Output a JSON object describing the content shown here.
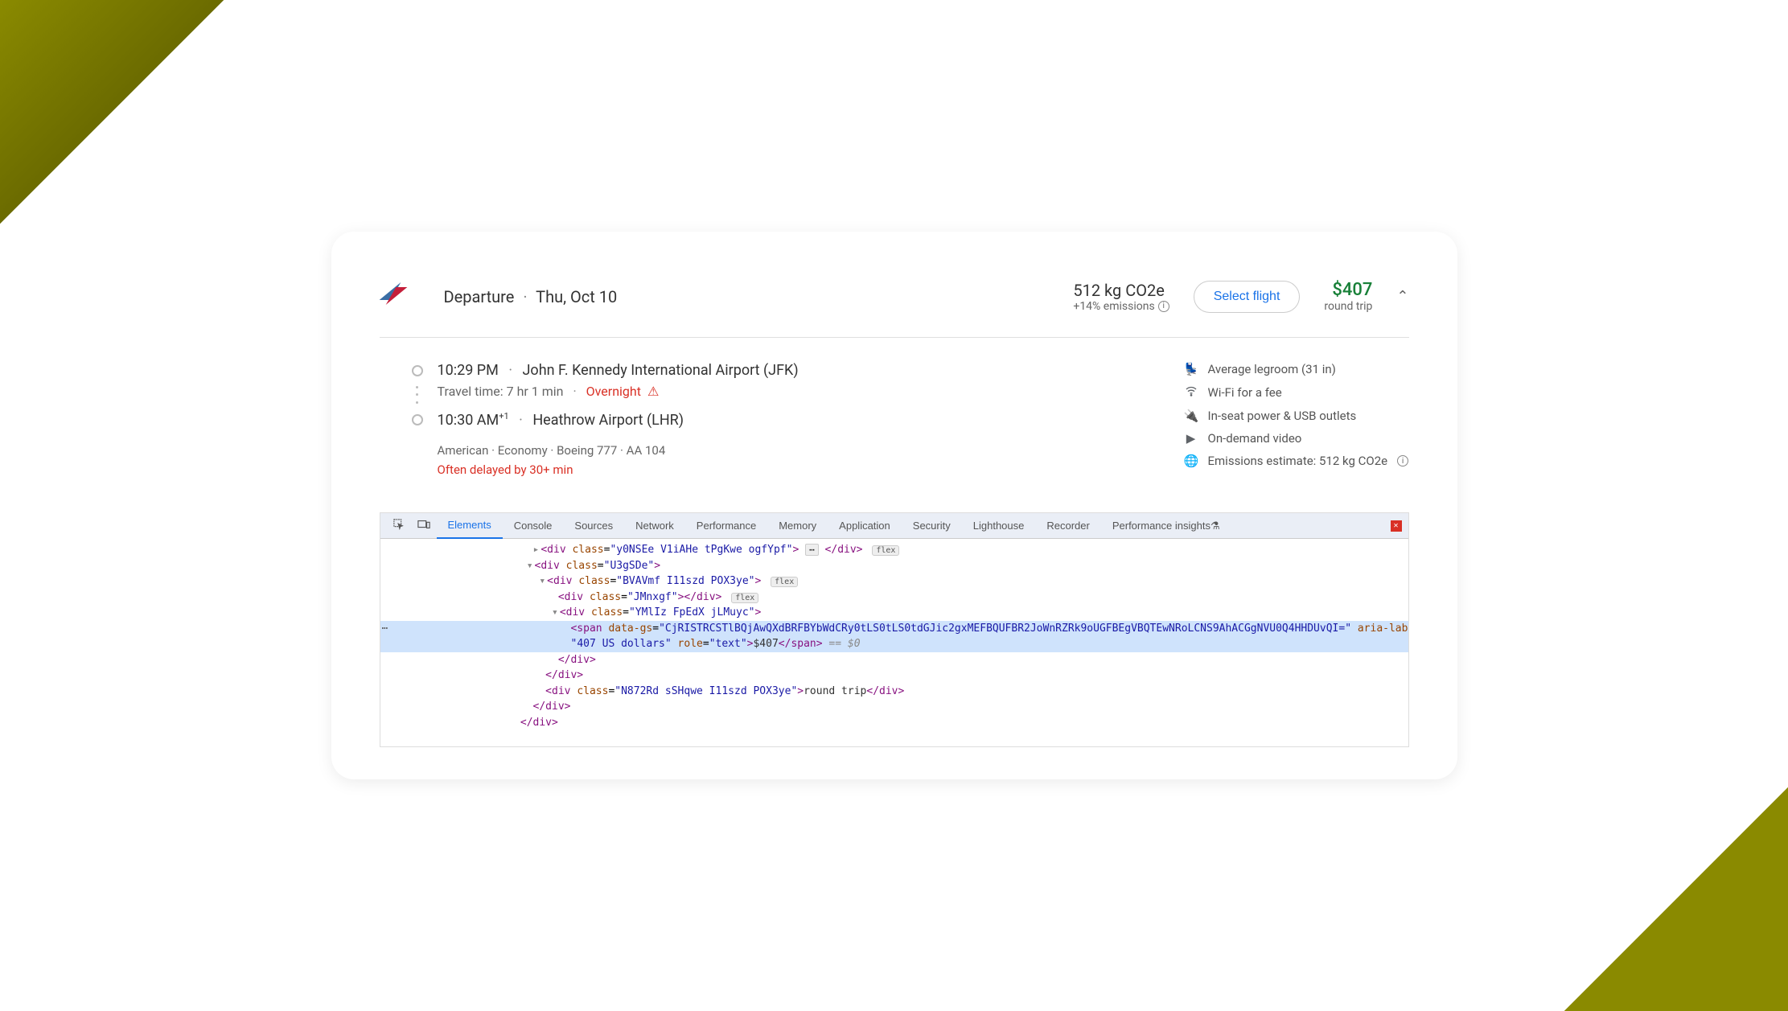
{
  "header": {
    "departure_label": "Departure",
    "date": "Thu, Oct 10"
  },
  "emissions": {
    "main": "512 kg CO2e",
    "delta": "+14% emissions"
  },
  "select_button": "Select flight",
  "price": "$407",
  "trip_type": "round trip",
  "itinerary": {
    "origin_time": "10:29 PM",
    "origin_airport": "John F. Kennedy International Airport (JFK)",
    "travel_time_label": "Travel time: 7 hr 1 min",
    "overnight": "Overnight",
    "dest_time": "10:30 AM",
    "dest_sup": "+1",
    "dest_airport": "Heathrow Airport (LHR)",
    "carrier": "American",
    "cabin": "Economy",
    "aircraft": "Boeing 777",
    "flight_no": "AA 104",
    "delayed": "Often delayed by 30+ min"
  },
  "amenities": [
    "Average legroom (31 in)",
    "Wi-Fi for a fee",
    "In-seat power & USB outlets",
    "On-demand video",
    "Emissions estimate: 512 kg CO2e"
  ],
  "devtools": {
    "tabs": [
      "Elements",
      "Console",
      "Sources",
      "Network",
      "Performance",
      "Memory",
      "Application",
      "Security",
      "Lighthouse",
      "Recorder",
      "Performance insights"
    ],
    "active_tab": "Elements",
    "code": {
      "l1_class": "y0NSEe V1iAHe tPgKwe ogfYpf",
      "l2_class": "U3gSDe",
      "l3_class": "BVAVmf I11szd POX3ye",
      "l4_class": "JMnxgf",
      "l5_class": "YMlIz FpEdX jLMuyc",
      "span_attr": "data-gs",
      "span_attr_val": "CjRISTRCSTlBQjAwQXdBRFBYbWdCRy0tLS0tLS0tdGJic2gxMEFBQUFBR2JoWnRZRk9oUGFBEgVBQTEwNRoLCNS9AhACGgNVU0Q4HHDUvQI=",
      "aria_label": "407 US dollars",
      "role": "text",
      "price_text": "$407",
      "eq": "== $0",
      "rt_class": "N872Rd sSHqwe I11szd POX3ye",
      "rt_text": "round trip"
    }
  }
}
